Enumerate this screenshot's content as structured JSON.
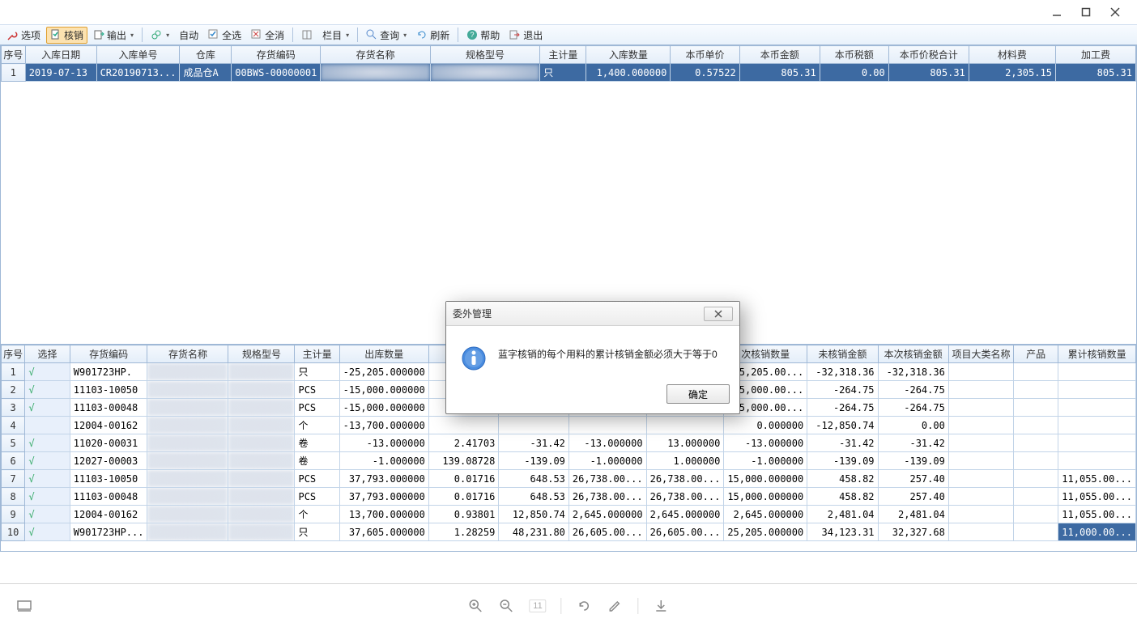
{
  "toolbar": {
    "options": "选项",
    "verify": "核销",
    "output": "输出",
    "auto": "自动",
    "select_all": "全选",
    "clear_all": "全消",
    "columns": "栏目",
    "query": "查询",
    "refresh": "刷新",
    "help": "帮助",
    "exit": "退出"
  },
  "top_table": {
    "headers": [
      "序号",
      "入库日期",
      "入库单号",
      "仓库",
      "存货编码",
      "存货名称",
      "规格型号",
      "主计量",
      "入库数量",
      "本币单价",
      "本币金额",
      "本币税额",
      "本币价税合计",
      "材料费",
      "加工费"
    ],
    "widths": [
      30,
      88,
      90,
      64,
      98,
      138,
      138,
      58,
      104,
      86,
      100,
      86,
      100,
      108,
      100
    ],
    "rows": [
      {
        "n": "1",
        "date": "2019-07-13",
        "no": "CR20190713...",
        "wh": "成品仓A",
        "code": "00BWS-00000001",
        "name": "",
        "spec": "",
        "uom": "只",
        "qty": "1,400.000000",
        "price": "0.57522",
        "amt": "805.31",
        "tax": "0.00",
        "total": "805.31",
        "mat": "2,305.15",
        "proc": "805.31"
      }
    ]
  },
  "bottom_table": {
    "headers": [
      "序号",
      "选择",
      "存货编码",
      "存货名称",
      "规格型号",
      "主计量",
      "出库数量",
      "",
      "",
      "",
      "",
      "次核销数量",
      "未核销金额",
      "本次核销金额",
      "项目大类名称",
      "产品",
      "累计核销数量"
    ],
    "widths": [
      30,
      60,
      80,
      110,
      90,
      58,
      102,
      88,
      88,
      88,
      88,
      88,
      88,
      88,
      88,
      60,
      90
    ],
    "rows": [
      {
        "n": "1",
        "sel": "√",
        "code": "W901723HP.",
        "name": "",
        "spec": "",
        "uom": "只",
        "qty": "-25,205.000000",
        "c7": "",
        "c8": "",
        "c9": "",
        "c10": "",
        "vq": "5,205.00...",
        "unv": "-32,318.36",
        "cur": "-32,318.36",
        "cat": "",
        "prod": "",
        "acc": ""
      },
      {
        "n": "2",
        "sel": "√",
        "code": "11103-10050",
        "name": "",
        "spec": "",
        "uom": "PCS",
        "qty": "-15,000.000000",
        "c7": "",
        "c8": "",
        "c9": "",
        "c10": "",
        "vq": "5,000.00...",
        "unv": "-264.75",
        "cur": "-264.75",
        "cat": "",
        "prod": "",
        "acc": ""
      },
      {
        "n": "3",
        "sel": "√",
        "code": "11103-00048",
        "name": "",
        "spec": "",
        "uom": "PCS",
        "qty": "-15,000.000000",
        "c7": "",
        "c8": "",
        "c9": "",
        "c10": "",
        "vq": "5,000.00...",
        "unv": "-264.75",
        "cur": "-264.75",
        "cat": "",
        "prod": "",
        "acc": ""
      },
      {
        "n": "4",
        "sel": "",
        "code": "12004-00162",
        "name": "",
        "spec": "",
        "uom": "个",
        "qty": "-13,700.000000",
        "c7": "",
        "c8": "",
        "c9": "",
        "c10": "",
        "vq": "0.000000",
        "unv": "-12,850.74",
        "cur": "0.00",
        "cat": "",
        "prod": "",
        "acc": ""
      },
      {
        "n": "5",
        "sel": "√",
        "code": "11020-00031",
        "name": "",
        "spec": "",
        "uom": "卷",
        "qty": "-13.000000",
        "c7": "2.41703",
        "c8": "-31.42",
        "c9": "-13.000000",
        "c10": "13.000000",
        "vq": "-13.000000",
        "unv": "-31.42",
        "cur": "-31.42",
        "cat": "",
        "prod": "",
        "acc": ""
      },
      {
        "n": "6",
        "sel": "√",
        "code": "12027-00003",
        "name": "",
        "spec": "",
        "uom": "卷",
        "qty": "-1.000000",
        "c7": "139.08728",
        "c8": "-139.09",
        "c9": "-1.000000",
        "c10": "1.000000",
        "vq": "-1.000000",
        "unv": "-139.09",
        "cur": "-139.09",
        "cat": "",
        "prod": "",
        "acc": ""
      },
      {
        "n": "7",
        "sel": "√",
        "code": "11103-10050",
        "name": "",
        "spec": "",
        "uom": "PCS",
        "qty": "37,793.000000",
        "c7": "0.01716",
        "c8": "648.53",
        "c9": "26,738.00...",
        "c10": "26,738.00...",
        "vq": "15,000.000000",
        "unv": "458.82",
        "cur": "257.40",
        "cat": "",
        "prod": "",
        "acc": "11,055.00..."
      },
      {
        "n": "8",
        "sel": "√",
        "code": "11103-00048",
        "name": "",
        "spec": "",
        "uom": "PCS",
        "qty": "37,793.000000",
        "c7": "0.01716",
        "c8": "648.53",
        "c9": "26,738.00...",
        "c10": "26,738.00...",
        "vq": "15,000.000000",
        "unv": "458.82",
        "cur": "257.40",
        "cat": "",
        "prod": "",
        "acc": "11,055.00..."
      },
      {
        "n": "9",
        "sel": "√",
        "code": "12004-00162",
        "name": "",
        "spec": "",
        "uom": "个",
        "qty": "13,700.000000",
        "c7": "0.93801",
        "c8": "12,850.74",
        "c9": "2,645.000000",
        "c10": "2,645.000000",
        "vq": "2,645.000000",
        "unv": "2,481.04",
        "cur": "2,481.04",
        "cat": "",
        "prod": "",
        "acc": "11,055.00..."
      },
      {
        "n": "10",
        "sel": "√",
        "code": "W901723HP...",
        "name": "",
        "spec": "",
        "uom": "只",
        "qty": "37,605.000000",
        "c7": "1.28259",
        "c8": "48,231.80",
        "c9": "26,605.00...",
        "c10": "26,605.00...",
        "vq": "25,205.000000",
        "unv": "34,123.31",
        "cur": "32,327.68",
        "cat": "",
        "prod": "",
        "acc": "11,000.00...",
        "hl": true
      }
    ]
  },
  "dialog": {
    "title": "委外管理",
    "message": "蓝字核销的每个用料的累计核销金额必须大于等于0",
    "ok": "确定"
  },
  "statusbar": {
    "page": "11"
  }
}
